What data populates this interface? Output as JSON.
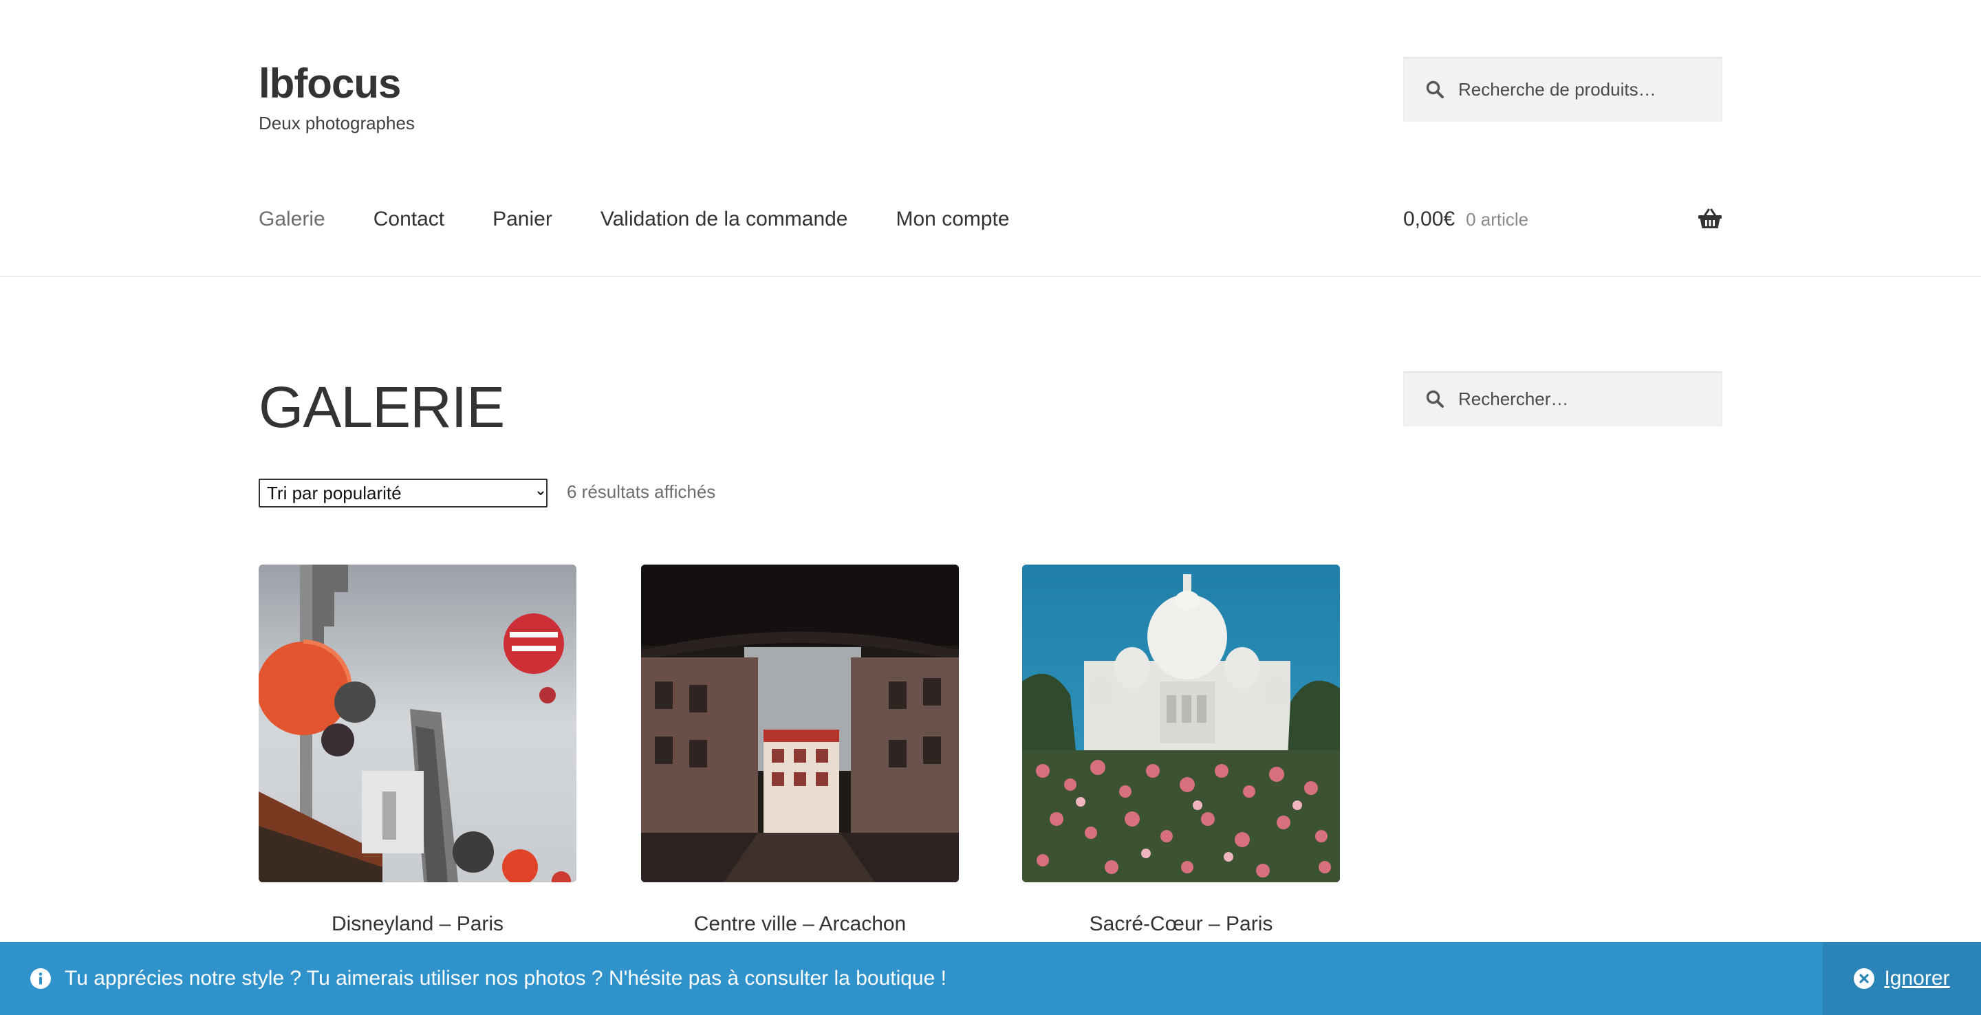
{
  "site": {
    "title": "lbfocus",
    "description": "Deux photographes"
  },
  "header_search": {
    "placeholder": "Recherche de produits…"
  },
  "nav": {
    "items": [
      {
        "label": "Galerie",
        "current": true
      },
      {
        "label": "Contact"
      },
      {
        "label": "Panier"
      },
      {
        "label": "Validation de la commande"
      },
      {
        "label": "Mon compte"
      }
    ]
  },
  "cart": {
    "amount": "0,00€",
    "count": "0 article",
    "icon": "basket-icon"
  },
  "page": {
    "title": "GALERIE",
    "orderby": {
      "selected": "Tri par popularité"
    },
    "result_count": "6 résultats affichés"
  },
  "sidebar_search": {
    "placeholder": "Rechercher…"
  },
  "products": [
    {
      "name": "Disneyland – Paris"
    },
    {
      "name": "Centre ville – Arcachon"
    },
    {
      "name": "Sacré-Cœur – Paris"
    }
  ],
  "store_notice": {
    "message": "Tu apprécies notre style ? Tu aimerais utiliser nos photos ? N'hésite pas à consulter la boutique !",
    "dismiss_label": "Ignorer"
  },
  "colors": {
    "notice_background": "#3092ca",
    "notice_dismiss_background": "#2b84b8",
    "search_background": "#f2f2f2"
  }
}
